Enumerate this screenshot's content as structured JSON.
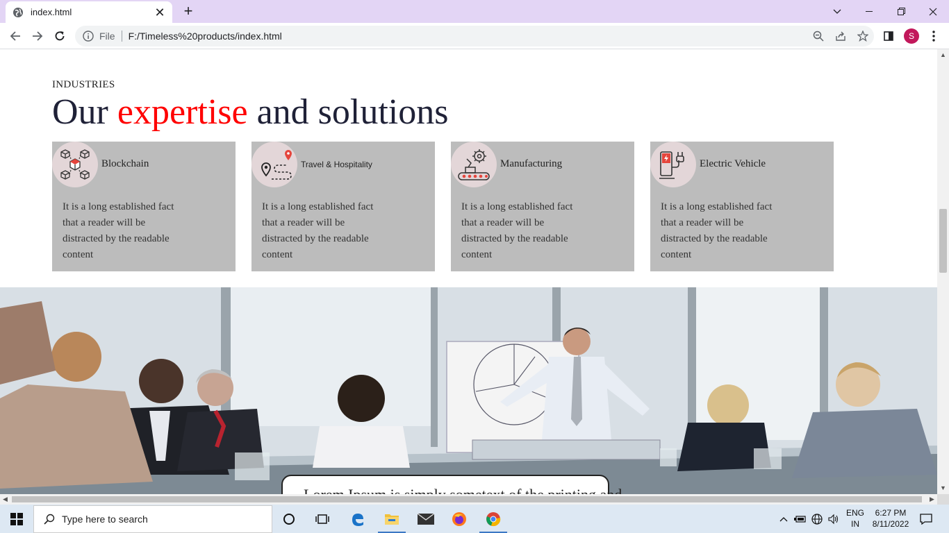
{
  "browser": {
    "tab_title": "index.html",
    "scheme": "File",
    "url": "F:/Timeless%20products/index.html",
    "profile_initial": "S",
    "icons": [
      "globe-icon",
      "close-icon",
      "plus-icon",
      "chevron-down-icon",
      "minimize-icon",
      "restore-icon",
      "close-window-icon",
      "back-icon",
      "forward-icon",
      "reload-icon",
      "info-icon",
      "zoom-icon",
      "share-icon",
      "star-icon",
      "side-panel-icon",
      "menu-icon"
    ]
  },
  "page": {
    "section_label": "INDUSTRIES",
    "headline": {
      "before": "Our ",
      "accent": "expertise",
      "after": " and solutions",
      "accent_color": "#ff0000"
    },
    "cards": [
      {
        "title": "Blockchain",
        "text": "It is a long established fact that a reader will be distracted by the readable content",
        "icon": "blockchain-icon"
      },
      {
        "title": "Travel & Hospitality",
        "text": "It is a long established fact that a reader will be distracted by the readable content",
        "icon": "travel-route-icon"
      },
      {
        "title": "Manufacturing",
        "text": "It is a long established fact that a reader will be distracted by the readable content",
        "icon": "manufacturing-icon"
      },
      {
        "title": "Electric Vehicle",
        "text": "It is a long established fact that a reader will be distracted by the readable content",
        "icon": "ev-charger-icon"
      }
    ],
    "hero_quote": "Lorem Ipsum is simply sometext of the printing and"
  },
  "taskbar": {
    "search_placeholder": "Type here to search",
    "lang_top": "ENG",
    "lang_bottom": "IN",
    "time": "6:27 PM",
    "date": "8/11/2022"
  }
}
